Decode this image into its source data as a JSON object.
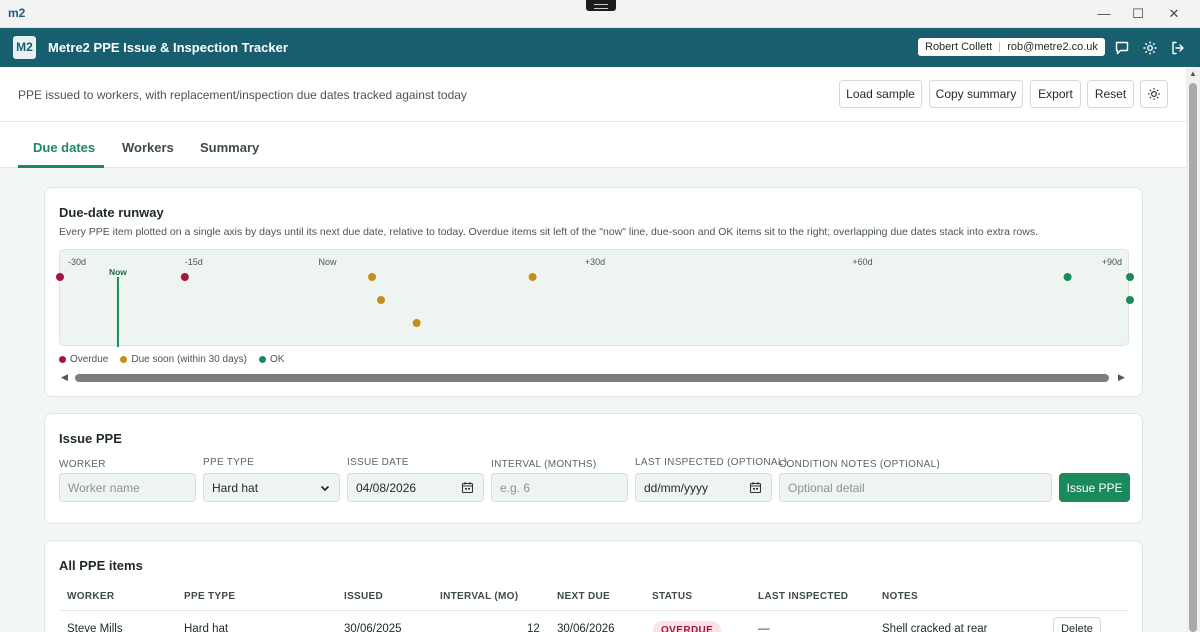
{
  "window": {
    "logo": "m2",
    "minimize": "—",
    "maximize": "☐",
    "close": "✕"
  },
  "header": {
    "badge": "M2",
    "title": "Metre2 PPE Issue & Inspection Tracker",
    "user_name": "Robert Collett",
    "user_email": "rob@metre2.co.uk",
    "icons": [
      "chat-icon",
      "gear-icon",
      "logout-icon"
    ]
  },
  "toolbar": {
    "description": "PPE issued to workers, with replacement/inspection due dates tracked against today",
    "load_sample": "Load sample",
    "copy_summary": "Copy summary",
    "export": "Export",
    "reset": "Reset",
    "theme_icon": "sun-icon"
  },
  "tabs": [
    {
      "label": "Due dates",
      "active": true
    },
    {
      "label": "Workers",
      "active": false
    },
    {
      "label": "Summary",
      "active": false
    }
  ],
  "runway": {
    "title": "Due-date runway",
    "description": "Every PPE item plotted on a single axis by days until its next due date, relative to today. Overdue items sit left of the \"now\" line, due-soon and OK items sit to the right; overlapping due dates stack into extra rows.",
    "now_label": "Now",
    "legend": [
      {
        "label": "Overdue",
        "color": "#a3173f"
      },
      {
        "label": "Due soon (within 30 days)",
        "color": "#c2901a"
      },
      {
        "label": "OK",
        "color": "#1a8a5c"
      }
    ]
  },
  "chart_data": {
    "type": "scatter",
    "title": "Due-date runway",
    "xlabel": "",
    "ylabel": "",
    "xlim": [
      -30,
      90
    ],
    "ticks": [
      {
        "value": -30,
        "label": "-30d"
      },
      {
        "value": -15,
        "label": "-15d"
      },
      {
        "value": 0,
        "label": "Now"
      },
      {
        "value": 30,
        "label": "+30d"
      },
      {
        "value": 60,
        "label": "+60d"
      },
      {
        "value": 90,
        "label": "+90d"
      }
    ],
    "now_value": -23.5,
    "points": [
      {
        "days": -30,
        "row": 0,
        "status": "overdue"
      },
      {
        "days": -16,
        "row": 0,
        "status": "overdue"
      },
      {
        "days": 5,
        "row": 0,
        "status": "soon"
      },
      {
        "days": 6,
        "row": 1,
        "status": "soon"
      },
      {
        "days": 10,
        "row": 2,
        "status": "soon"
      },
      {
        "days": 23,
        "row": 0,
        "status": "soon"
      },
      {
        "days": 83,
        "row": 0,
        "status": "ok"
      },
      {
        "days": 117,
        "row": 0,
        "status": "ok"
      },
      {
        "days": 117,
        "row": 1,
        "status": "ok"
      }
    ]
  },
  "issue": {
    "title": "Issue PPE",
    "worker_label": "WORKER",
    "worker_placeholder": "Worker name",
    "type_label": "PPE TYPE",
    "type_value": "Hard hat",
    "date_label": "ISSUE DATE",
    "date_value": "04/08/2026",
    "interval_label": "INTERVAL (MONTHS)",
    "interval_placeholder": "e.g. 6",
    "inspected_label": "LAST INSPECTED (OPTIONAL)",
    "inspected_placeholder": "dd/mm/yyyy",
    "notes_label": "CONDITION NOTES (OPTIONAL)",
    "notes_placeholder": "Optional detail",
    "submit": "Issue PPE"
  },
  "table": {
    "title": "All PPE items",
    "columns": [
      "WORKER",
      "PPE TYPE",
      "ISSUED",
      "INTERVAL (MO)",
      "NEXT DUE",
      "STATUS",
      "LAST INSPECTED",
      "NOTES"
    ],
    "rows": [
      {
        "worker": "Steve Mills",
        "type": "Hard hat",
        "issued": "30/06/2025",
        "interval": "12",
        "next_due": "30/06/2026",
        "status": "OVERDUE",
        "last_inspected": "—",
        "notes": "Shell cracked at rear",
        "action": "Delete"
      }
    ]
  }
}
